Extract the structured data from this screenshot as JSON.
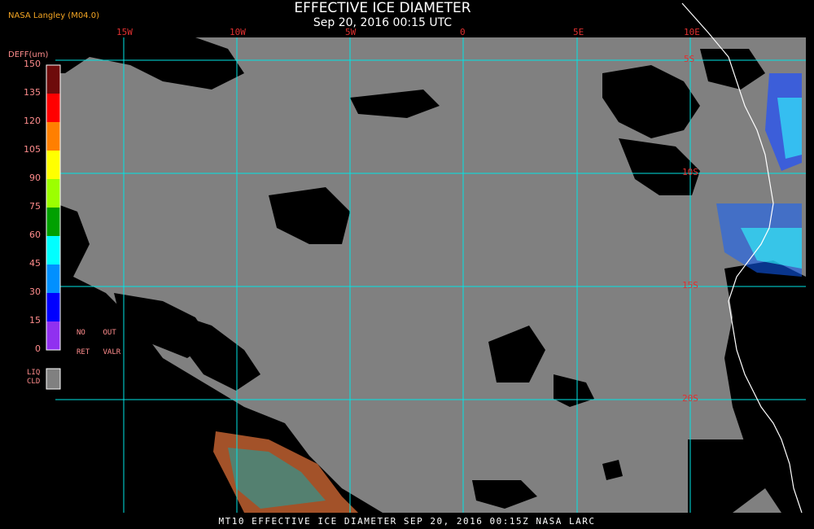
{
  "header": {
    "title": "EFFECTIVE ICE DIAMETER",
    "subtitle": "Sep 20, 2016 00:15 UTC",
    "source": "NASA Langley (M04.0)"
  },
  "longitude_labels": [
    "15W",
    "10W",
    "5W",
    "0",
    "5E",
    "10E"
  ],
  "latitude_labels": [
    "5S",
    "10S",
    "15S",
    "20S"
  ],
  "legend": {
    "title": "DEFF(um)",
    "ticks": [
      "150",
      "135",
      "120",
      "105",
      "90",
      "75",
      "60",
      "45",
      "30",
      "15",
      "0"
    ],
    "colors": [
      "#6e0b0b",
      "#ff0000",
      "#ff7f00",
      "#ffff00",
      "#9cff00",
      "#00a000",
      "#00ffff",
      "#0090ff",
      "#0000ff",
      "#9030f0"
    ],
    "no_ret": "NO    OUT",
    "ret_valr": "RET   VALR",
    "liq_label_1": "LIQ",
    "liq_label_2": "CLD",
    "liq_color": "#808080"
  },
  "footer": {
    "text": "MT10  EFFECTIVE ICE DIAMETER  SEP 20, 2016 00:15Z  NASA LARC"
  },
  "colors": {
    "grid": "#00e5e5",
    "clear": "#000000",
    "liquid": "#808080",
    "coast": "#ffffff"
  }
}
